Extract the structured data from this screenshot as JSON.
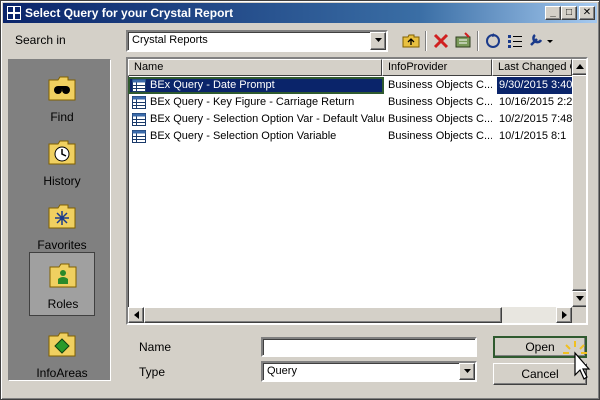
{
  "window": {
    "title": "Select Query for your Crystal Report",
    "controls": {
      "minimize": "_",
      "maximize": "□",
      "close": "✕"
    }
  },
  "search_in": {
    "label": "Search in",
    "value": "Crystal Reports"
  },
  "toolbar": {
    "icons": [
      "up-folder-icon",
      "delete-icon",
      "new-folder-icon",
      "refresh-icon",
      "details-view-icon",
      "tools-menu-icon"
    ]
  },
  "places": [
    {
      "label": "Find",
      "icon": "find-binoculars-icon"
    },
    {
      "label": "History",
      "icon": "history-clock-icon"
    },
    {
      "label": "Favorites",
      "icon": "favorites-star-icon"
    },
    {
      "label": "Roles",
      "icon": "roles-person-icon",
      "selected": true
    },
    {
      "label": "InfoAreas",
      "icon": "infoareas-diamond-icon"
    }
  ],
  "file_list": {
    "columns": [
      "Name",
      "InfoProvider",
      "Last Changed O"
    ],
    "rows": [
      {
        "name": "BEx Query - Date Prompt",
        "provider": "Business Objects C...",
        "changed": "9/30/2015 3:40",
        "selected": true
      },
      {
        "name": "BEx Query - Key Figure - Carriage Return",
        "provider": "Business Objects C...",
        "changed": "10/16/2015 2:2"
      },
      {
        "name": "BEx Query - Selection Option Var - Default Value",
        "provider": "Business Objects C...",
        "changed": "10/2/2015 7:48"
      },
      {
        "name": "BEx Query - Selection Option Variable",
        "provider": "Business Objects C...",
        "changed": "10/1/2015 8:1"
      }
    ]
  },
  "form": {
    "name_label": "Name",
    "name_value": "",
    "type_label": "Type",
    "type_value": "Query"
  },
  "buttons": {
    "open": "Open",
    "cancel": "Cancel"
  },
  "colors": {
    "selection": "#0a246a",
    "highlight_outline": "#2f5a2f",
    "dialog_face": "#d4d0c8"
  }
}
